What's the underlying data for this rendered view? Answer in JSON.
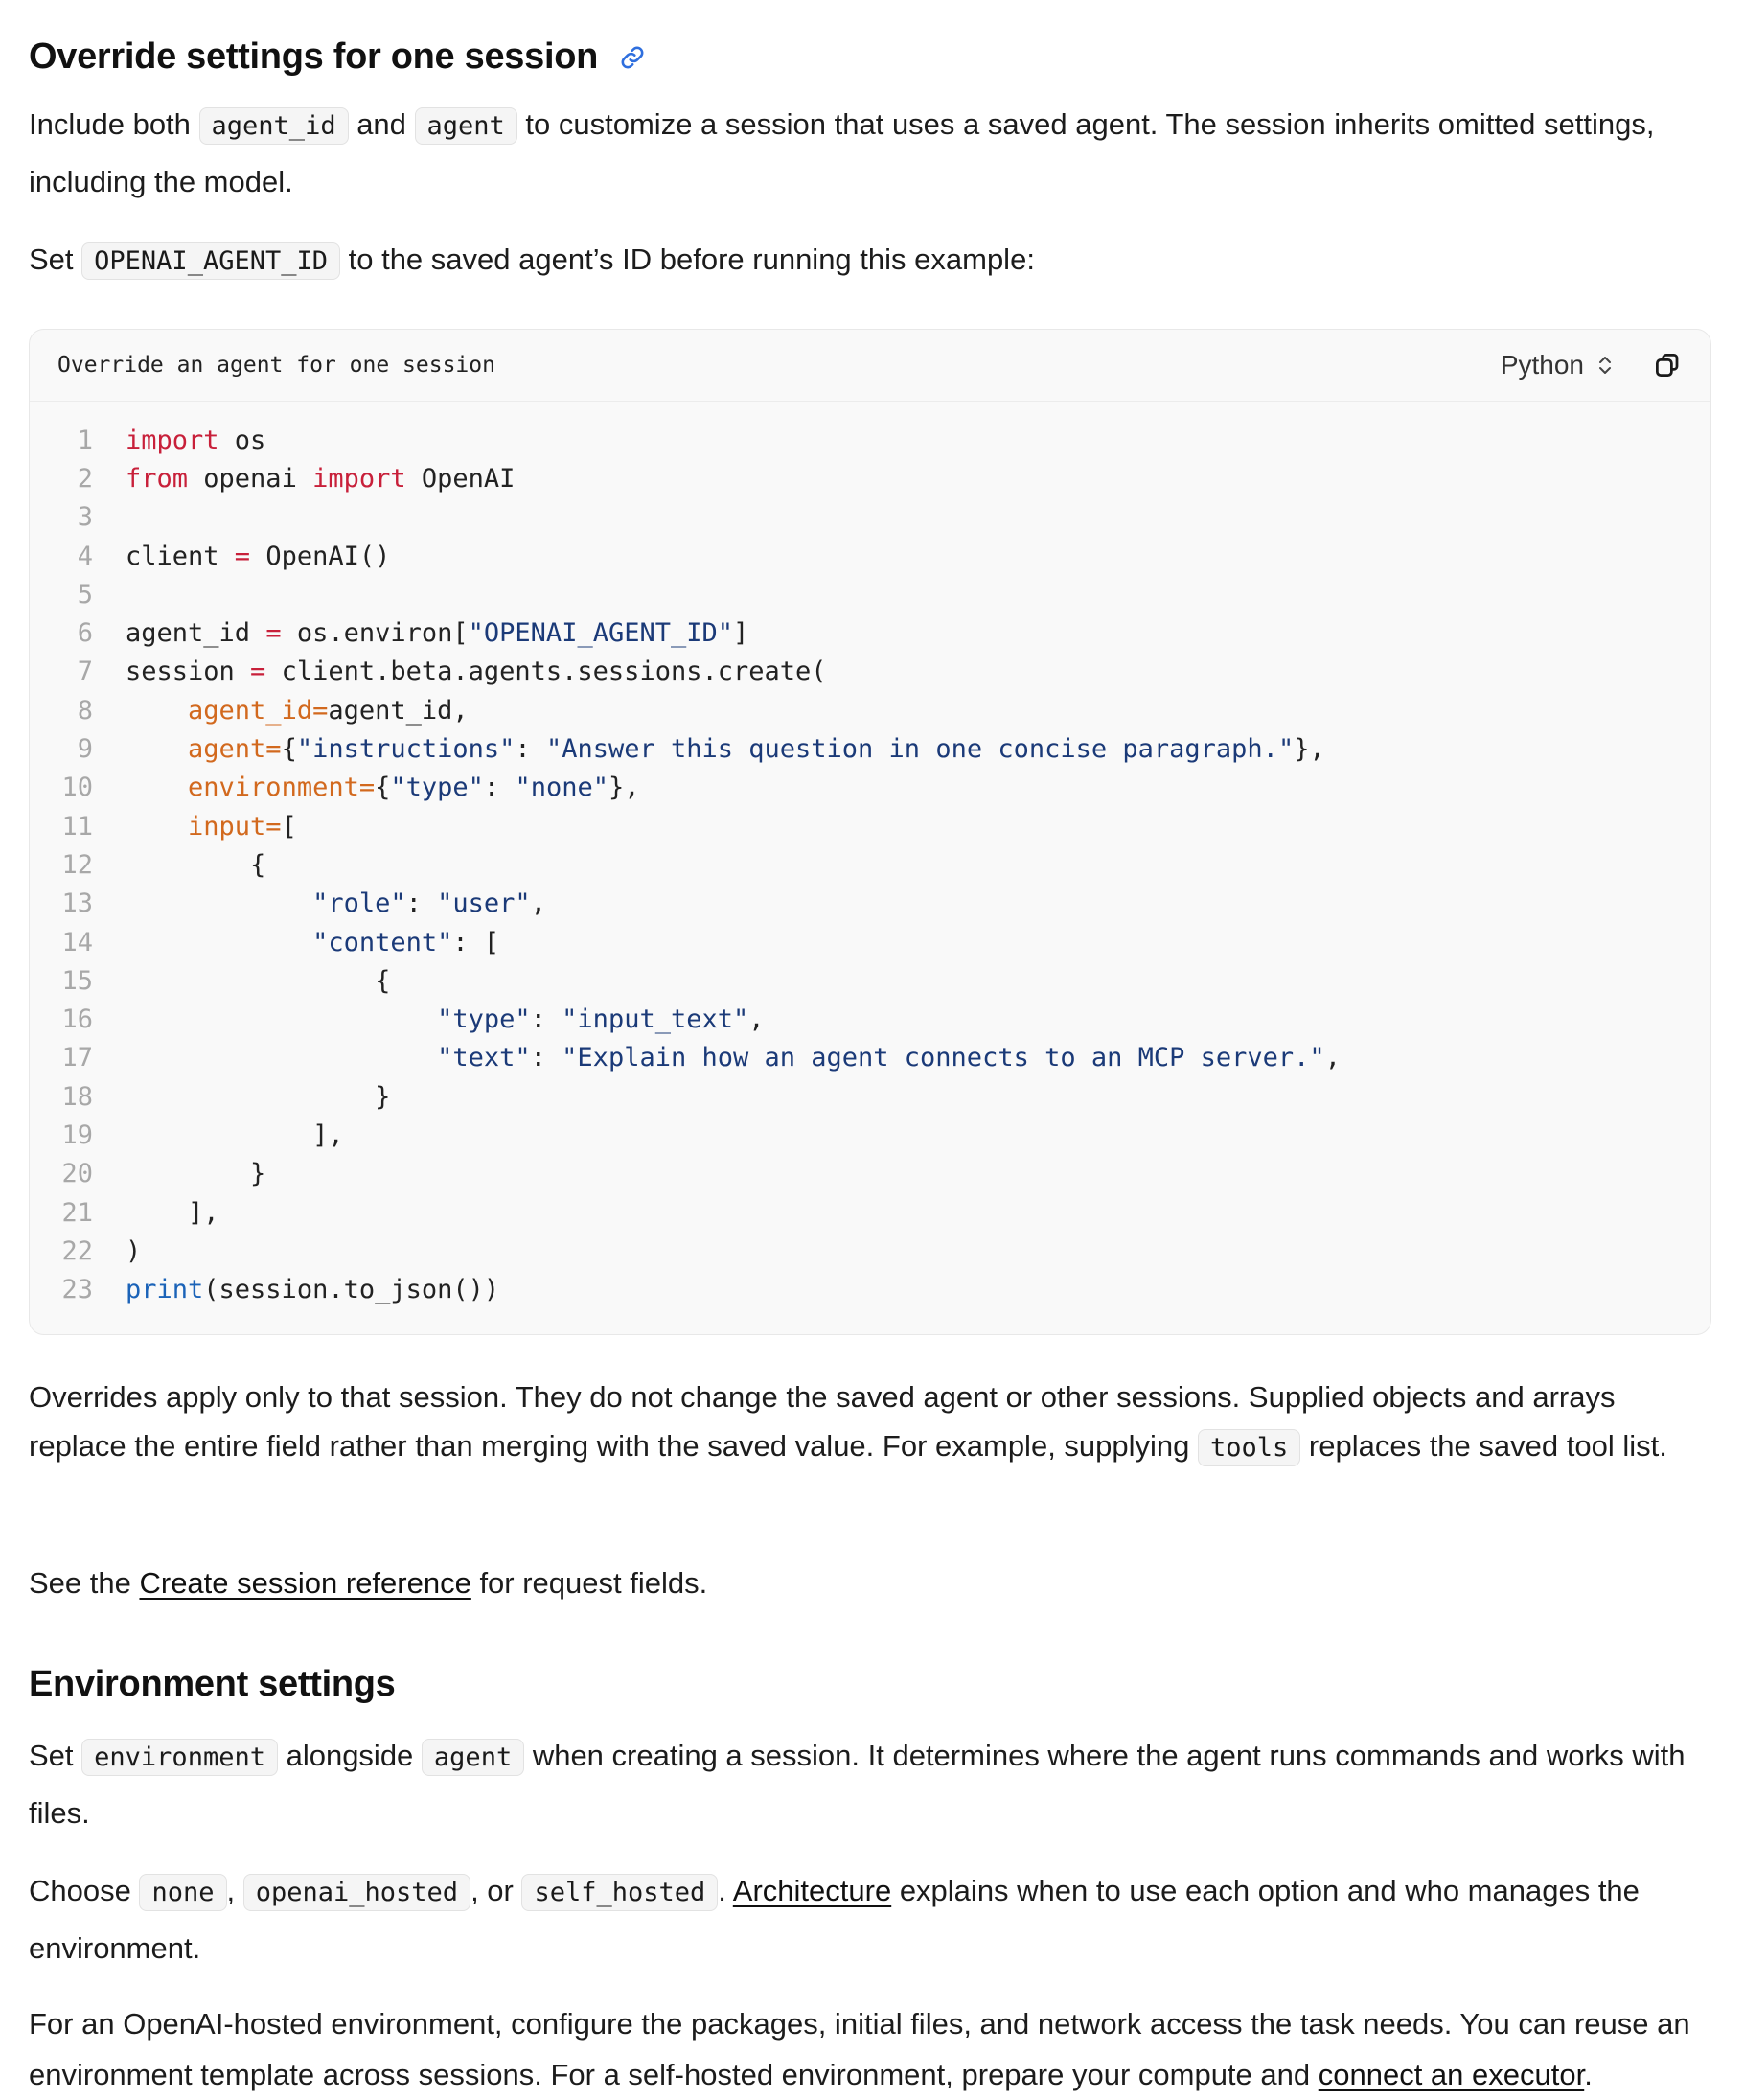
{
  "section1": {
    "heading": "Override settings for one session",
    "p1": {
      "t1": "Include both ",
      "code1": "agent_id",
      "t2": " and ",
      "code2": "agent",
      "t3": " to customize a session that uses a saved agent. The session inherits omitted settings, including the model."
    },
    "p2": {
      "t1": "Set ",
      "code1": "OPENAI_AGENT_ID",
      "t2": " to the saved agent’s ID before running this example:"
    }
  },
  "code_block": {
    "title": "Override an agent for one session",
    "language": "Python",
    "lines": [
      "1",
      "2",
      "3",
      "4",
      "5",
      "6",
      "7",
      "8",
      "9",
      "10",
      "11",
      "12",
      "13",
      "14",
      "15",
      "16",
      "17",
      "18",
      "19",
      "20",
      "21",
      "22",
      "23"
    ]
  },
  "after_code": {
    "p1": {
      "t1": "Overrides apply only to that session. They do not change the saved agent or other sessions. Supplied objects and arrays replace the entire field rather than merging with the saved value. For example, supplying ",
      "code1": "tools",
      "t2": " replaces the saved tool list."
    },
    "p2": {
      "t1": "See the ",
      "link": "Create session reference",
      "t2": " for request fields."
    }
  },
  "section2": {
    "heading": "Environment settings",
    "p1": {
      "t1": "Set ",
      "code1": "environment",
      "t2": " alongside ",
      "code2": "agent",
      "t3": " when creating a session. It determines where the agent runs commands and works with files."
    },
    "p2": {
      "t1": "Choose ",
      "code1": "none",
      "t2": ", ",
      "code2": "openai_hosted",
      "t3": ", or ",
      "code3": "self_hosted",
      "t4": ". ",
      "link": "Architecture",
      "t5": " explains when to use each option and who manages the environment."
    },
    "p3": {
      "t1": "For an OpenAI-hosted environment, configure the packages, initial files, and network access the task needs. You can reuse an environment template across sessions. For a self-hosted environment, prepare your compute and ",
      "link": "connect an executor",
      "t2": "."
    }
  },
  "icons": {
    "heading_link": "link-icon",
    "language_select": "chevron-up-down-icon",
    "copy": "copy-icon"
  },
  "colors": {
    "keyword": "#c8203a",
    "string": "#1b3a78",
    "argument": "#d2691e",
    "builtin": "#1b63b8",
    "link_icon": "#2f6fde"
  }
}
